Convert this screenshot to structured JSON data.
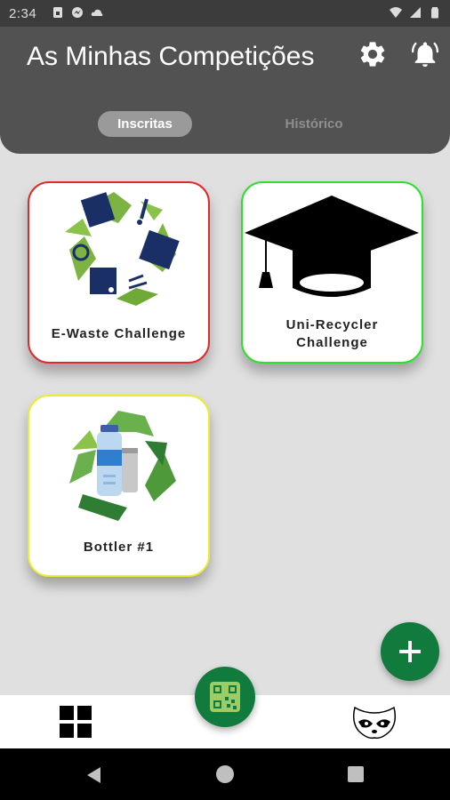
{
  "status_bar": {
    "time": "2:34",
    "icons": [
      "sim-icon",
      "messenger-icon",
      "cloud-icon",
      "wifi-icon",
      "signal-icon",
      "battery-icon"
    ]
  },
  "header": {
    "title": "As Minhas Competições",
    "settings_icon": "gear-icon",
    "notifications_icon": "bell-icon",
    "tabs": [
      {
        "label": "Inscritas",
        "active": true
      },
      {
        "label": "Histórico",
        "active": false
      }
    ]
  },
  "competitions": [
    {
      "label": "E-Waste Challenge",
      "image": "e-waste-recycle-icon",
      "border_color": "#e02a2a"
    },
    {
      "label": "Uni-Recycler Challenge",
      "image": "graduation-cap-icon",
      "border_color": "#2ce02c"
    },
    {
      "label": "Bottler #1",
      "image": "bottle-recycle-icon",
      "border_color": "#ecec33"
    }
  ],
  "actions": {
    "add_icon": "plus-icon",
    "scan_icon": "qr-code-icon"
  },
  "bottom_nav": {
    "items": [
      {
        "icon": "dashboard-grid-icon"
      },
      {
        "icon": "raccoon-icon"
      }
    ]
  },
  "colors": {
    "header_bg": "#525252",
    "accent_green": "#117a3d",
    "background": "#e0e0e0"
  }
}
